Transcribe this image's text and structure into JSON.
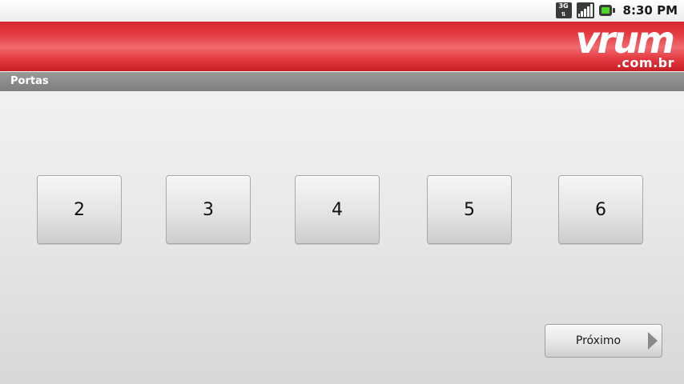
{
  "status_bar": {
    "network_type": "3G",
    "network_arrows": "⇅",
    "time": "8:30 PM",
    "network_icon": "3g-data-icon",
    "signal_icon": "signal-strength-icon",
    "battery_icon": "battery-icon",
    "battery_color": "#4ad623"
  },
  "header": {
    "logo_word": "vrum",
    "logo_domain": ".com.br",
    "background_color": "#e1333b"
  },
  "title_bar": {
    "title": "Portas"
  },
  "options": [
    {
      "label": "2"
    },
    {
      "label": "3"
    },
    {
      "label": "4"
    },
    {
      "label": "5"
    },
    {
      "label": "6"
    }
  ],
  "next_button": {
    "label": "Próximo",
    "icon": "chevron-right-icon"
  }
}
